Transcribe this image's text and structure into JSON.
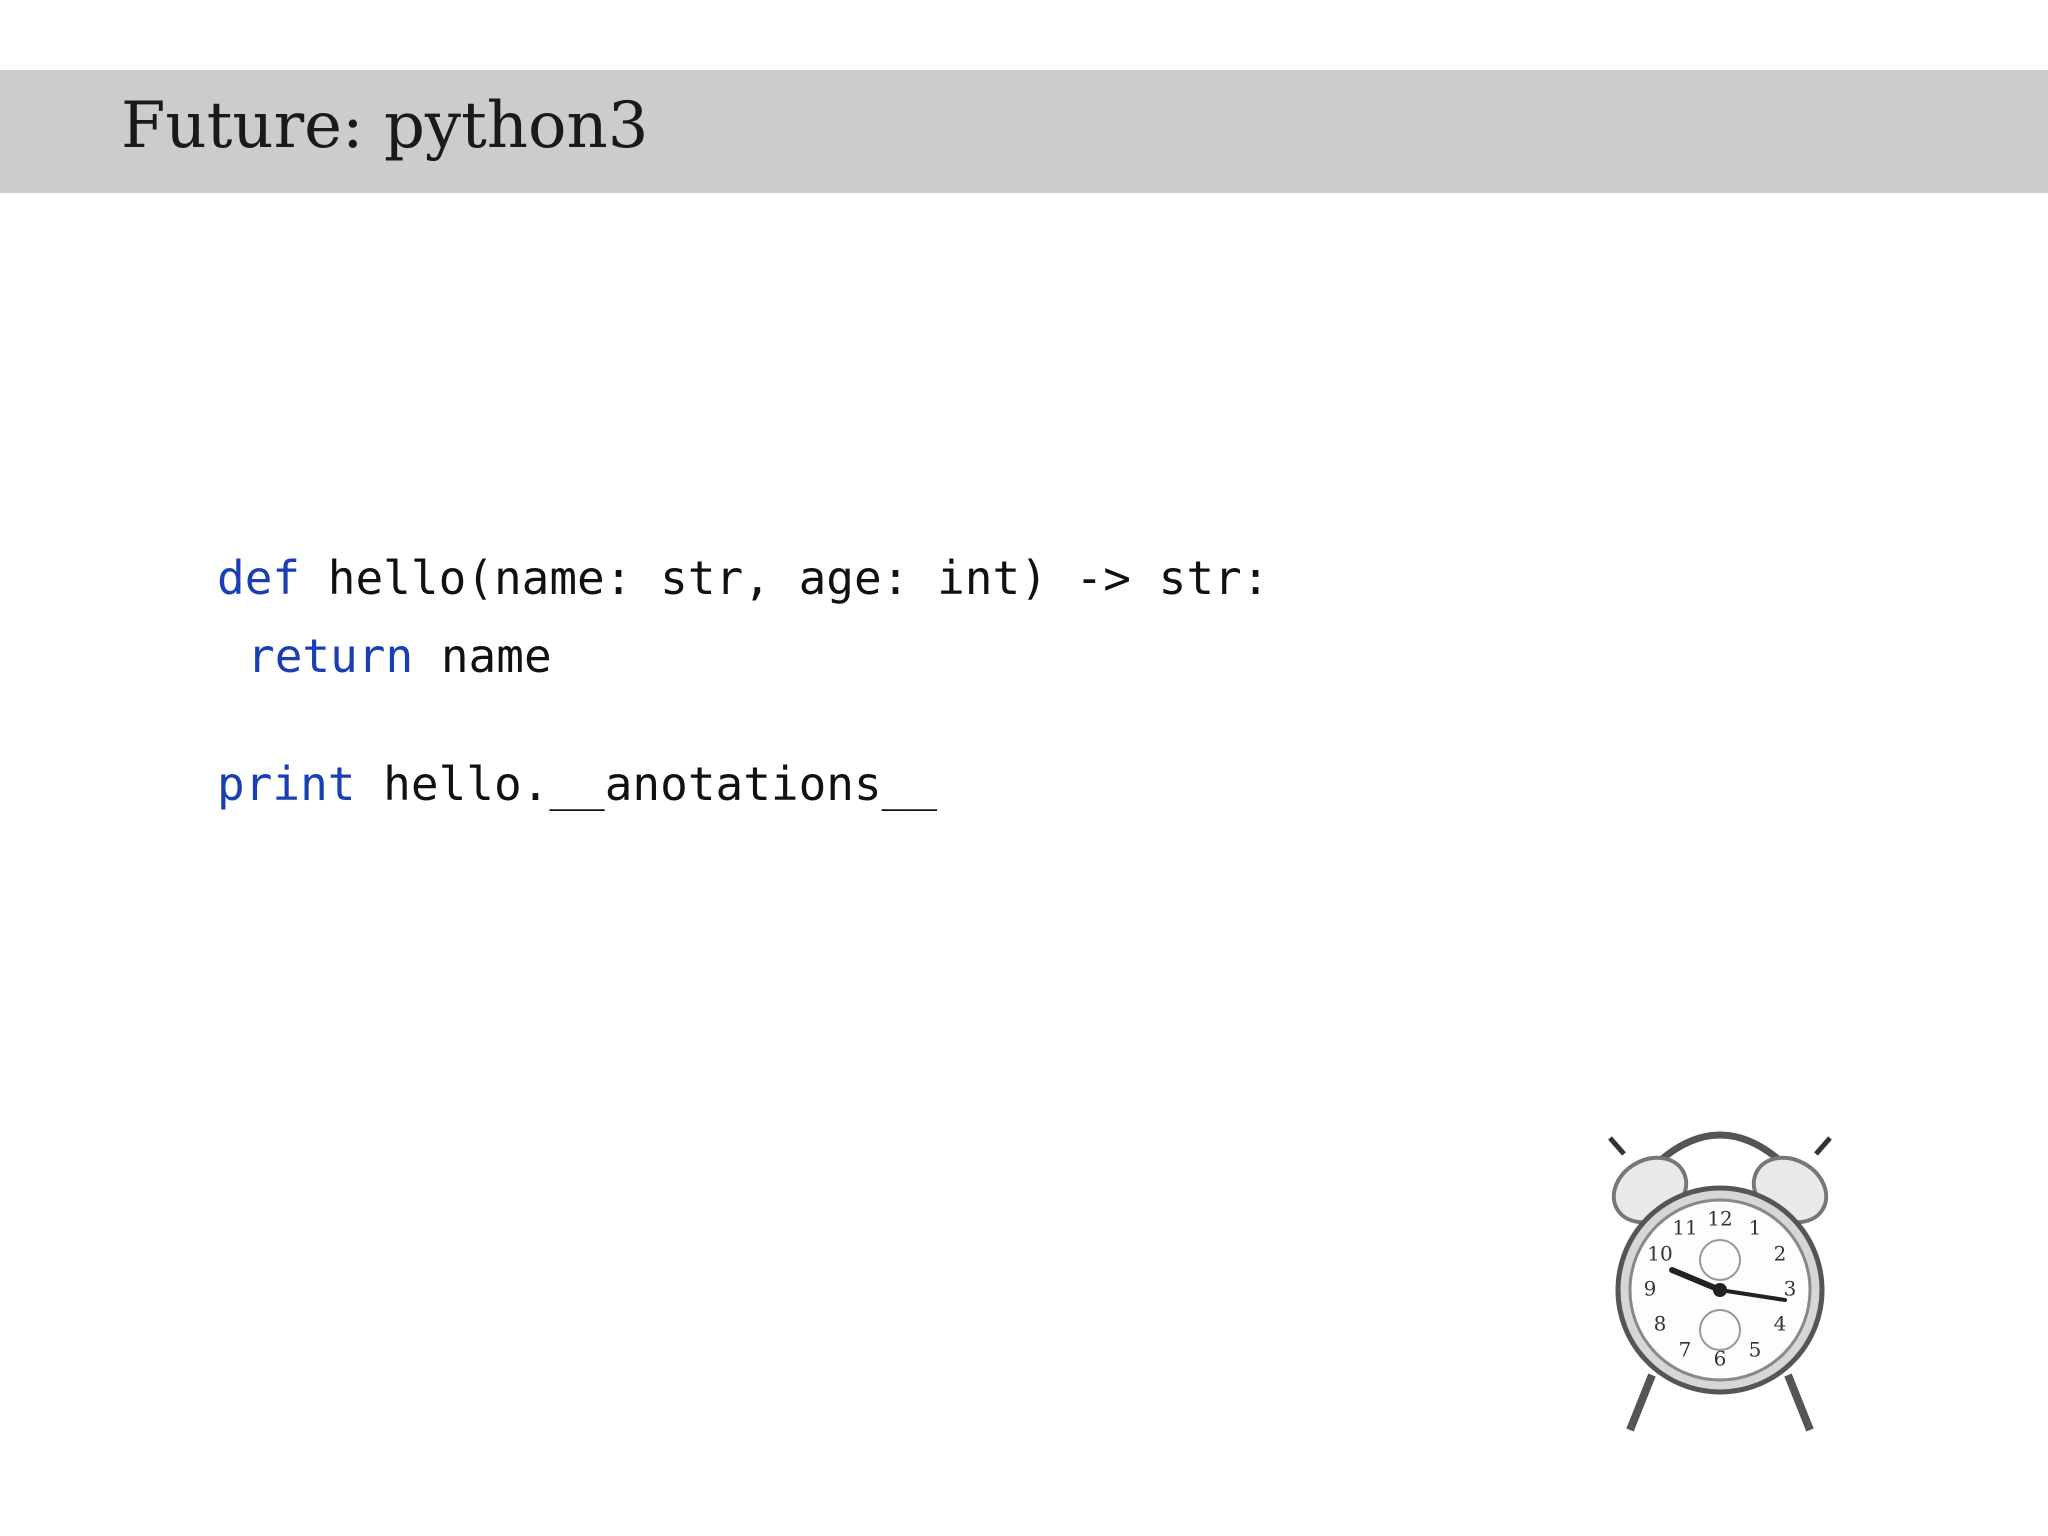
{
  "slide": {
    "title": "Future: python3"
  },
  "code": {
    "line1": {
      "keyword": "def",
      "rest": " hello(name: str, age: int) -> str:"
    },
    "line2": {
      "keyword": "return",
      "rest": " name"
    },
    "line3": {
      "keyword": "print",
      "rest": " hello.__anotations__"
    }
  },
  "colors": {
    "title_bar": "#cccccc",
    "keyword": "#1a3fb5",
    "text": "#111111"
  },
  "clock": {
    "icon": "alarm-clock-icon",
    "dial_numbers": [
      "12",
      "1",
      "2",
      "3",
      "4",
      "5",
      "6",
      "7",
      "8",
      "9",
      "10",
      "11"
    ]
  }
}
